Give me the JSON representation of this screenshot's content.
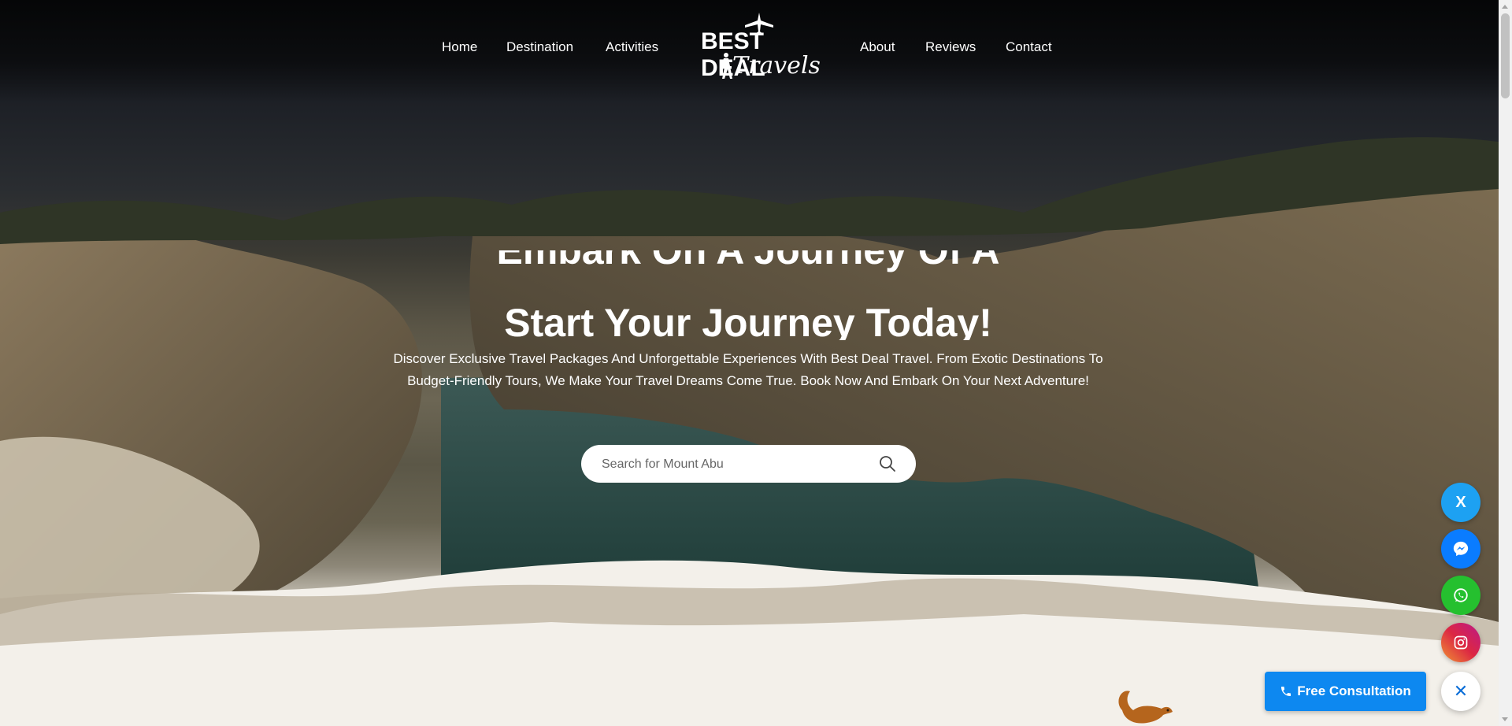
{
  "nav": {
    "links": [
      "Home",
      "Destination",
      "Activities",
      "About",
      "Reviews",
      "Contact"
    ],
    "logo_top": "BEST DEAL",
    "logo_script": "Travels"
  },
  "hero": {
    "title_partial": "Embark On A Journey Of A Lifetime!",
    "title": "Start Your Journey Today!",
    "description": "Discover Exclusive Travel Packages And Unforgettable Experiences With Best Deal Travel. From Exotic Destinations To Budget-Friendly Tours, We Make Your Travel Dreams Come True. Book Now And Embark On Your Next Adventure!"
  },
  "search": {
    "placeholder": "Search for Mount Abu",
    "icon": "search-icon"
  },
  "social": [
    {
      "name": "x-twitter",
      "icon": "X",
      "color": "#1da1f2"
    },
    {
      "name": "messenger",
      "icon": "messenger-icon",
      "color": "#0a7cff"
    },
    {
      "name": "whatsapp",
      "icon": "whatsapp-icon",
      "color": "#25c02f"
    },
    {
      "name": "instagram",
      "icon": "instagram-icon",
      "color": "#c13584"
    }
  ],
  "consultation": {
    "label": "Free Consultation",
    "icon": "phone-icon",
    "color": "#0d88f0"
  },
  "close": {
    "label": "✕"
  }
}
